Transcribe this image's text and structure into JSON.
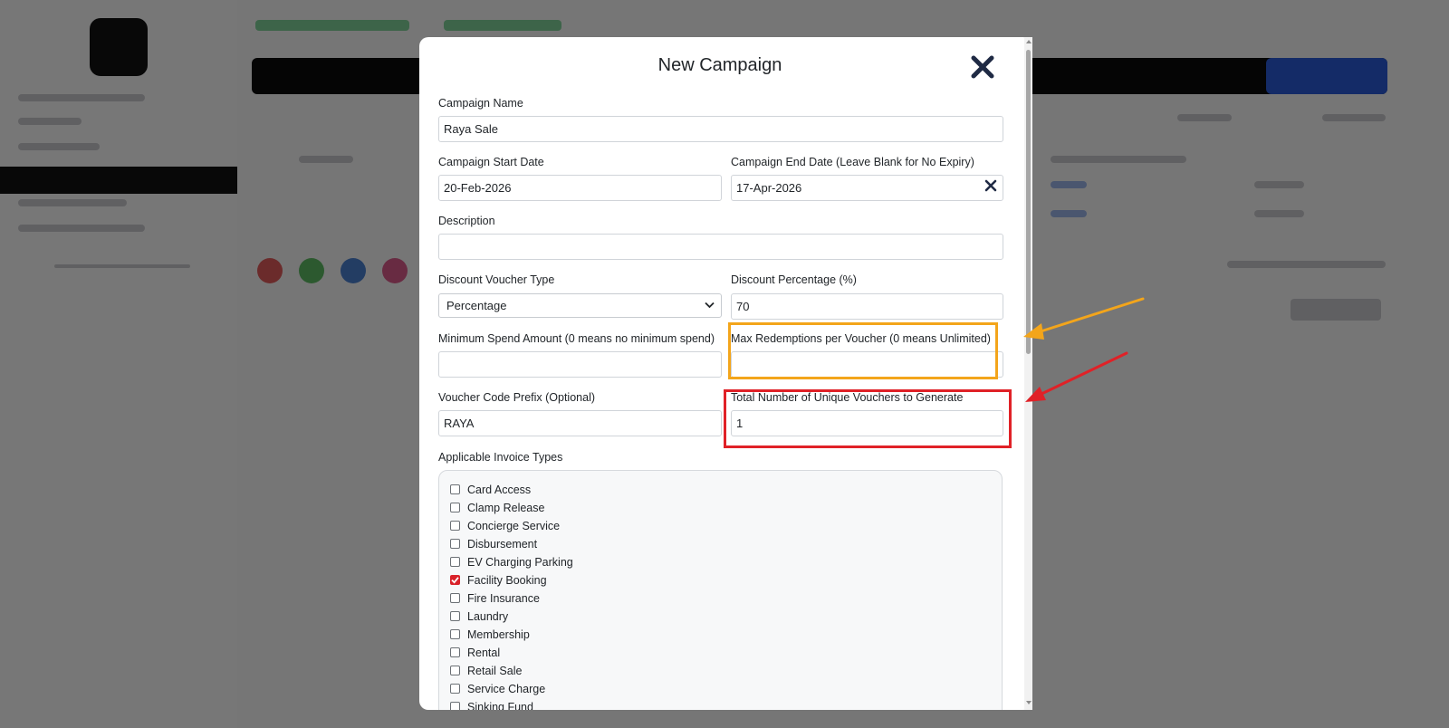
{
  "modal": {
    "title": "New Campaign"
  },
  "form": {
    "campaign_name": {
      "label": "Campaign Name",
      "value": "Raya Sale"
    },
    "start_date": {
      "label": "Campaign Start Date",
      "value": "20-Feb-2026"
    },
    "end_date": {
      "label": "Campaign End Date (Leave Blank for No Expiry)",
      "value": "17-Apr-2026"
    },
    "description": {
      "label": "Description",
      "value": ""
    },
    "voucher_type": {
      "label": "Discount Voucher Type",
      "selected": "Percentage"
    },
    "discount_percentage": {
      "label": "Discount Percentage (%)",
      "value": "70"
    },
    "min_spend": {
      "label": "Minimum Spend Amount (0 means no minimum spend)",
      "value": ""
    },
    "max_redemptions": {
      "label": "Max Redemptions per Voucher (0 means Unlimited)",
      "value": ""
    },
    "code_prefix": {
      "label": "Voucher Code Prefix (Optional)",
      "value": "RAYA"
    },
    "total_vouchers": {
      "label": "Total Number of Unique Vouchers to Generate",
      "value": "1"
    },
    "invoice_types": {
      "label": "Applicable Invoice Types",
      "items": [
        {
          "label": "Card Access",
          "checked": false
        },
        {
          "label": "Clamp Release",
          "checked": false
        },
        {
          "label": "Concierge Service",
          "checked": false
        },
        {
          "label": "Disbursement",
          "checked": false
        },
        {
          "label": "EV Charging Parking",
          "checked": false
        },
        {
          "label": "Facility Booking",
          "checked": true
        },
        {
          "label": "Fire Insurance",
          "checked": false
        },
        {
          "label": "Laundry",
          "checked": false
        },
        {
          "label": "Membership",
          "checked": false
        },
        {
          "label": "Rental",
          "checked": false
        },
        {
          "label": "Retail Sale",
          "checked": false
        },
        {
          "label": "Service Charge",
          "checked": false
        },
        {
          "label": "Sinking Fund",
          "checked": false
        }
      ]
    }
  },
  "colors": {
    "checkbox_checked": "#d9222a",
    "highlight_orange": "#f3a51b",
    "highlight_red": "#e02127",
    "arrow_orange": "#f3a51b",
    "arrow_red": "#e02127"
  }
}
